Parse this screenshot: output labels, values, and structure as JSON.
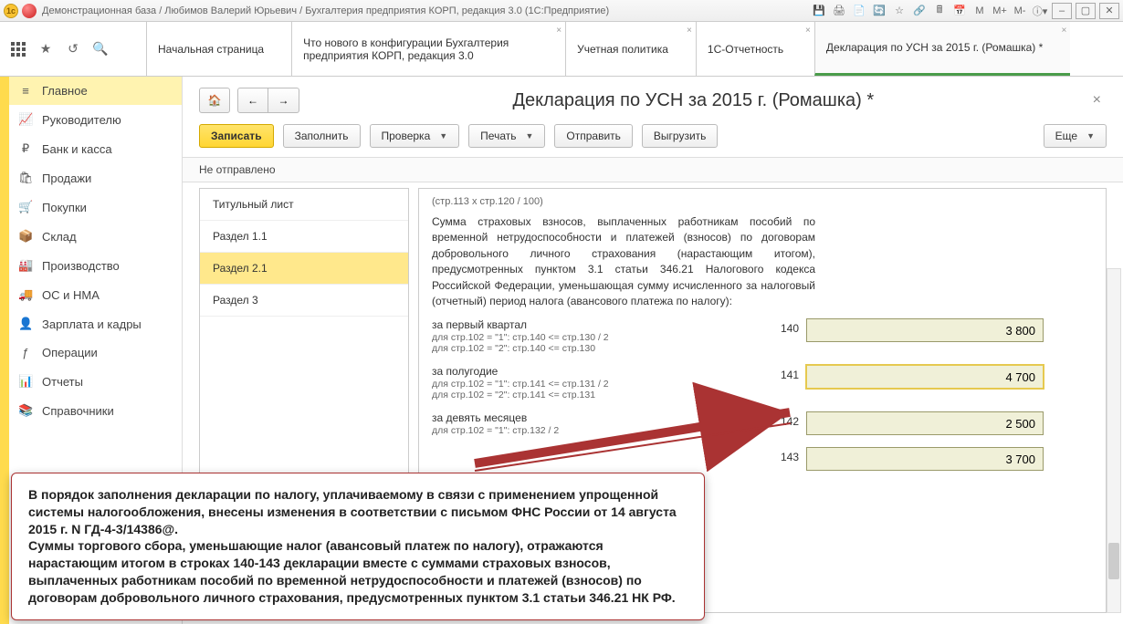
{
  "titlebar": {
    "text": "Демонстрационная база / Любимов Валерий Юрьевич / Бухгалтерия предприятия КОРП, редакция 3.0  (1С:Предприятие)",
    "m": "M",
    "mplus": "M+",
    "mminus": "M-"
  },
  "tabs": [
    {
      "label": "Начальная страница"
    },
    {
      "label": "Что нового в конфигурации Бухгалтерия предприятия КОРП, редакция 3.0"
    },
    {
      "label": "Учетная политика"
    },
    {
      "label": "1С-Отчетность"
    },
    {
      "label": "Декларация по УСН за 2015 г. (Ромашка) *",
      "active": true
    }
  ],
  "sidebar": [
    {
      "icon": "≡",
      "label": "Главное",
      "active": true
    },
    {
      "icon": "📈",
      "label": "Руководителю"
    },
    {
      "icon": "₽",
      "label": "Банк и касса"
    },
    {
      "icon": "🛍",
      "label": "Продажи"
    },
    {
      "icon": "🛒",
      "label": "Покупки"
    },
    {
      "icon": "📦",
      "label": "Склад"
    },
    {
      "icon": "🏭",
      "label": "Производство"
    },
    {
      "icon": "🚚",
      "label": "ОС и НМА"
    },
    {
      "icon": "👤",
      "label": "Зарплата и кадры"
    },
    {
      "icon": "ƒ",
      "label": "Операции"
    },
    {
      "icon": "📊",
      "label": "Отчеты"
    },
    {
      "icon": "📚",
      "label": "Справочники"
    }
  ],
  "doc": {
    "title": "Декларация по УСН за 2015 г. (Ромашка) *",
    "write": "Записать",
    "fill": "Заполнить",
    "check": "Проверка",
    "print": "Печать",
    "send": "Отправить",
    "export": "Выгрузить",
    "more": "Еще",
    "status": "Не отправлено"
  },
  "sections": [
    {
      "label": "Титульный лист"
    },
    {
      "label": "Раздел 1.1"
    },
    {
      "label": "Раздел 2.1",
      "active": true
    },
    {
      "label": "Раздел 3"
    }
  ],
  "form": {
    "formula": "(стр.113 x стр.120 / 100)",
    "paragraph": "Сумма страховых взносов, выплаченных работникам пособий по временной нетрудоспособности и платежей (взносов) по договорам добровольного личного страхования (нарастающим итогом), предусмотренных пунктом 3.1 статьи 346.21 Налогового кодекса Российской Федерации, уменьшающая сумму исчисленного за налоговый (отчетный) период налога (авансового платежа по налогу):",
    "rows": [
      {
        "period": "за первый квартал",
        "r1": "для стр.102 = \"1\": стр.140 <= стр.130 / 2",
        "r2": "для стр.102 = \"2\": стр.140 <= стр.130",
        "code": "140",
        "val": "3 800"
      },
      {
        "period": "за полугодие",
        "r1": "для стр.102 = \"1\": стр.141 <= стр.131 / 2",
        "r2": "для стр.102 = \"2\": стр.141 <= стр.131",
        "code": "141",
        "val": "4 700",
        "hl": true
      },
      {
        "period": "за девять месяцев",
        "r1": "для стр.102 = \"1\": стр.132 / 2",
        "r2": "",
        "code": "142",
        "val": "2 500"
      },
      {
        "period": "",
        "r1": "",
        "r2": "",
        "code": "143",
        "val": "3 700"
      }
    ]
  },
  "callout": {
    "l1": "В порядок заполнения декларации по налогу, уплачиваемому в связи с применением упрощенной системы налогообложения, внесены изменения в соответствии с письмом ФНС России от 14 августа 2015 г. N ГД-4-3/14386@.",
    "l2": "Суммы торгового сбора, уменьшающие налог (авансовый платеж по налогу), отражаются нарастающим итогом в строках 140-143 декларации вместе с суммами страховых взносов, выплаченных работникам пособий по временной нетрудоспособности и платежей (взносов) по договорам добровольного личного страхования, предусмотренных пунктом 3.1 статьи 346.21 НК РФ."
  }
}
